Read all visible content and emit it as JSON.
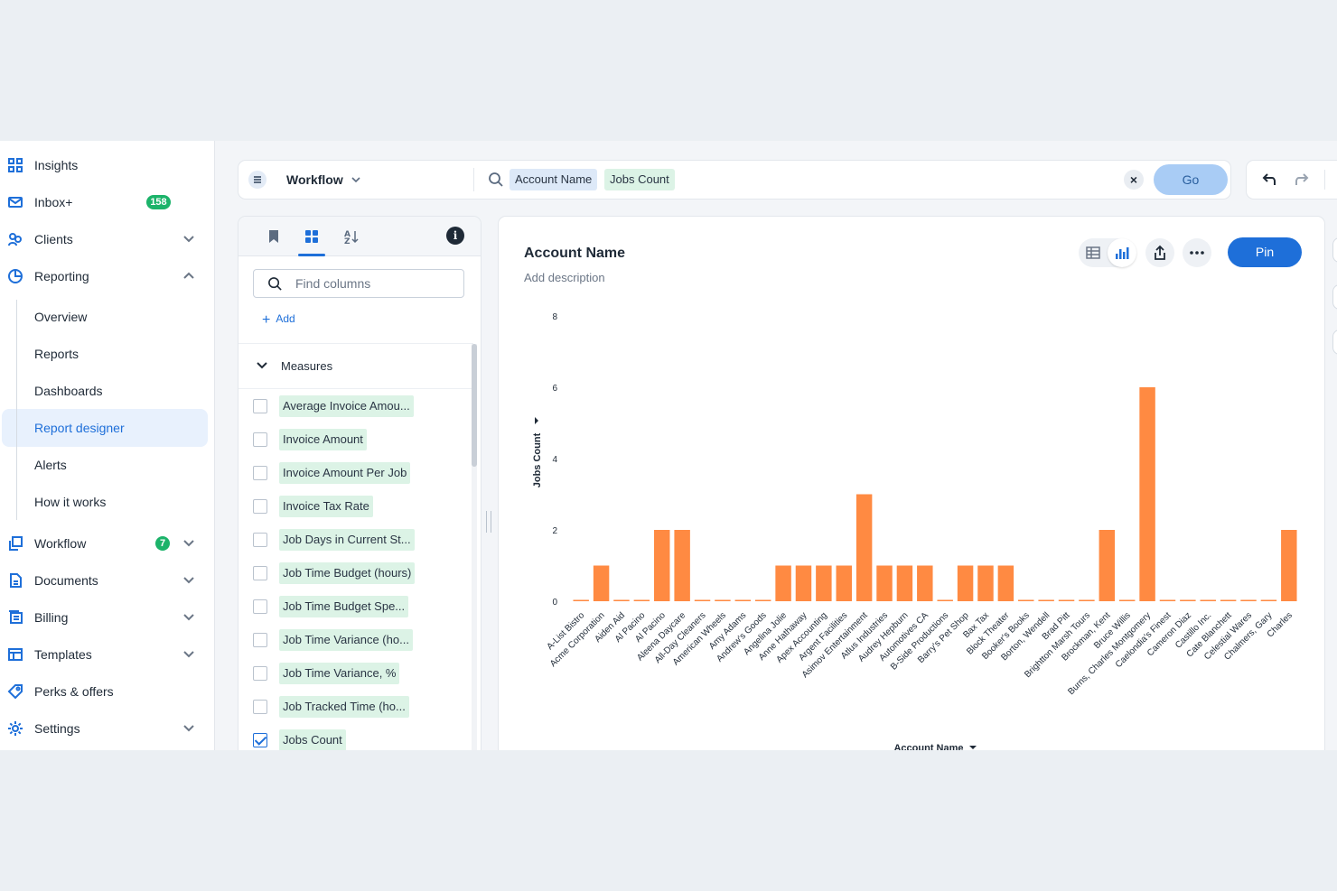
{
  "sidebar": {
    "items": [
      {
        "key": "insights",
        "label": "Insights",
        "icon": "grid-icon"
      },
      {
        "key": "inbox",
        "label": "Inbox+",
        "icon": "mail-icon",
        "badge": "158"
      },
      {
        "key": "clients",
        "label": "Clients",
        "icon": "users-icon",
        "expandable": true
      },
      {
        "key": "reporting",
        "label": "Reporting",
        "icon": "pie-chart-icon",
        "expanded": true
      },
      {
        "key": "workflow",
        "label": "Workflow",
        "icon": "copy-icon",
        "badge": "7",
        "expandable": true
      },
      {
        "key": "documents",
        "label": "Documents",
        "icon": "document-icon",
        "expandable": true
      },
      {
        "key": "billing",
        "label": "Billing",
        "icon": "billing-icon",
        "expandable": true
      },
      {
        "key": "templates",
        "label": "Templates",
        "icon": "template-icon",
        "expandable": true
      },
      {
        "key": "perks",
        "label": "Perks & offers",
        "icon": "tag-icon"
      },
      {
        "key": "settings",
        "label": "Settings",
        "icon": "gear-icon",
        "expandable": true
      }
    ],
    "reporting_sub": [
      {
        "label": "Overview"
      },
      {
        "label": "Reports"
      },
      {
        "label": "Dashboards"
      },
      {
        "label": "Report designer",
        "active": true
      },
      {
        "label": "Alerts"
      },
      {
        "label": "How it works"
      }
    ]
  },
  "querybar": {
    "source": "Workflow",
    "chips": [
      "Account Name",
      "Jobs Count"
    ],
    "go_label": "Go"
  },
  "columns_panel": {
    "search_placeholder": "Find columns",
    "add_label": "Add",
    "section_label": "Measures",
    "columns": [
      {
        "label": "Average Invoice Amou...",
        "checked": false
      },
      {
        "label": "Invoice Amount",
        "checked": false
      },
      {
        "label": "Invoice Amount Per Job",
        "checked": false
      },
      {
        "label": "Invoice Tax Rate",
        "checked": false
      },
      {
        "label": "Job Days in Current St...",
        "checked": false
      },
      {
        "label": "Job Time Budget (hours)",
        "checked": false
      },
      {
        "label": "Job Time Budget Spe...",
        "checked": false
      },
      {
        "label": "Job Time Variance (ho...",
        "checked": false
      },
      {
        "label": "Job Time Variance, %",
        "checked": false
      },
      {
        "label": "Job Tracked Time (ho...",
        "checked": false
      },
      {
        "label": "Jobs Count",
        "checked": true
      }
    ]
  },
  "chart_panel": {
    "title": "Account Name",
    "description": "Add description",
    "pin_label": "Pin",
    "accent_color": "#1e6fd9",
    "bar_color": "#ff8a42"
  },
  "chart_data": {
    "type": "bar",
    "xlabel": "Account Name",
    "ylabel": "Jobs Count",
    "ylim": [
      0,
      8
    ],
    "yticks": [
      0,
      2,
      4,
      6,
      8
    ],
    "categories": [
      "A-List Bistro",
      "Acme Corporation",
      "Aiden Aid",
      "Al Pacino",
      "Al Pacino",
      "Aleena Daycare",
      "All-Day Cleaners",
      "American Wheels",
      "Amy Adams",
      "Andrew's Goods",
      "Angelina Jolie",
      "Anne Hathaway",
      "Apex Accounting",
      "Argent Facilities",
      "Asimov Entertainment",
      "Atlus Industries",
      "Audrey Hepburn",
      "Automotives CA",
      "B-Side Productions",
      "Barry's Pet Shop",
      "Bax Tax",
      "Block Theater",
      "Booker's Books",
      "Borton, Wendell",
      "Brad Pitt",
      "Brightton Marsh Tours",
      "Brockman, Kent",
      "Bruce Willis",
      "Burns, Charles Montgomery",
      "Caelondia's Finest",
      "Cameron Diaz",
      "Castillo Inc.",
      "Cate Blanchett",
      "Celestial Wares",
      "Chalmers, Gary",
      "Charles"
    ],
    "values": [
      0,
      1,
      0,
      0,
      2,
      2,
      0,
      0,
      0,
      0,
      1,
      1,
      1,
      1,
      3,
      1,
      1,
      1,
      0,
      1,
      1,
      1,
      0,
      0,
      0,
      0,
      2,
      0,
      6,
      0,
      0,
      0,
      0,
      0,
      0,
      2
    ]
  }
}
